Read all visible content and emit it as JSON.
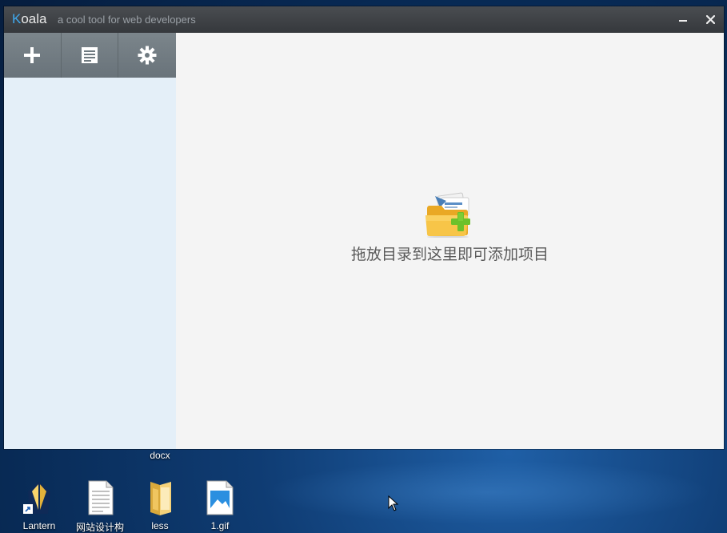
{
  "window": {
    "app_name_first": "K",
    "app_name_rest": "oala",
    "tagline": "a cool tool for web developers"
  },
  "toolbar": {
    "icons": [
      "add-icon",
      "document-icon",
      "gear-icon"
    ]
  },
  "main": {
    "empty_message": "拖放目录到这里即可添加项目"
  },
  "desktop": {
    "partial_label": "docx",
    "icons": [
      {
        "label": "Lantern",
        "icon": "lantern-icon"
      },
      {
        "label": "网站设计构",
        "icon": "document-icon"
      },
      {
        "label": "less",
        "icon": "folder-icon"
      },
      {
        "label": "1.gif",
        "icon": "image-file-icon"
      }
    ]
  },
  "colors": {
    "accent": "#3fa9ee",
    "titlebar": "#3d4044",
    "toolbar": "#6f7a80",
    "sidebar": "#e4eff8",
    "main_bg": "#f4f4f4",
    "plus_green": "#6cc12a"
  }
}
